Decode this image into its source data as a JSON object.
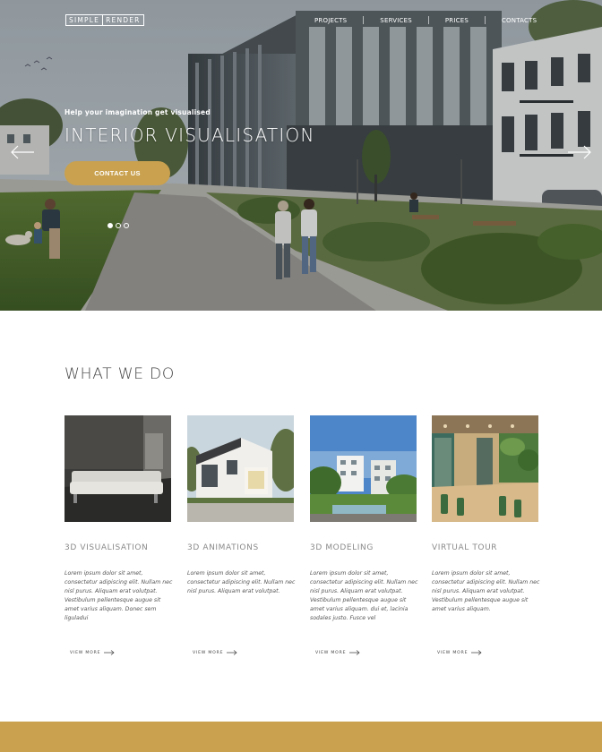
{
  "brand": {
    "logo_left": "SIMPLE",
    "logo_right": "RENDER"
  },
  "nav": {
    "items": [
      "PROJECTS",
      "SERVICES",
      "PRICES",
      "CONTACTS"
    ]
  },
  "hero": {
    "kicker": "Help your imagination get visualised",
    "title": "INTERIOR VISUALISATION",
    "cta_label": "CONTACT US",
    "slides_total": 3,
    "active_slide": 1
  },
  "services": {
    "title": "WHAT WE DO",
    "items": [
      {
        "name": "3D VISUALISATION",
        "desc": "Lorem ipsum dolor sit amet, consectetur adipiscing elit. Nullam nec nisl purus. Aliquam erat volutpat. Vestibulum pellentesque augue sit amet varius aliquam. Donec sem liguladui",
        "more": "VIEW MORE"
      },
      {
        "name": "3D ANIMATIONS",
        "desc": "Lorem ipsum dolor sit amet, consectetur adipiscing elit. Nullam nec nisl purus. Aliquam erat volutpat.",
        "more": "VIEW MORE"
      },
      {
        "name": "3D MODELING",
        "desc": "Lorem ipsum dolor sit amet, consectetur adipiscing elit. Nullam nec nisl purus. Aliquam erat volutpat. Vestibulum pellentesque augue sit amet varius aliquam. dui et, lacinia sodales justo. Fusce vel",
        "more": "VIEW MORE"
      },
      {
        "name": "VIRTUAL TOUR",
        "desc": "Lorem ipsum dolor sit amet, consectetur adipiscing elit. Nullam nec nisl purus. Aliquam erat volutpat. Vestibulum pellentesque augue sit amet varius aliquam.",
        "more": "VIEW MORE"
      }
    ]
  },
  "colors": {
    "accent": "#c9a14f",
    "text": "#444444"
  }
}
